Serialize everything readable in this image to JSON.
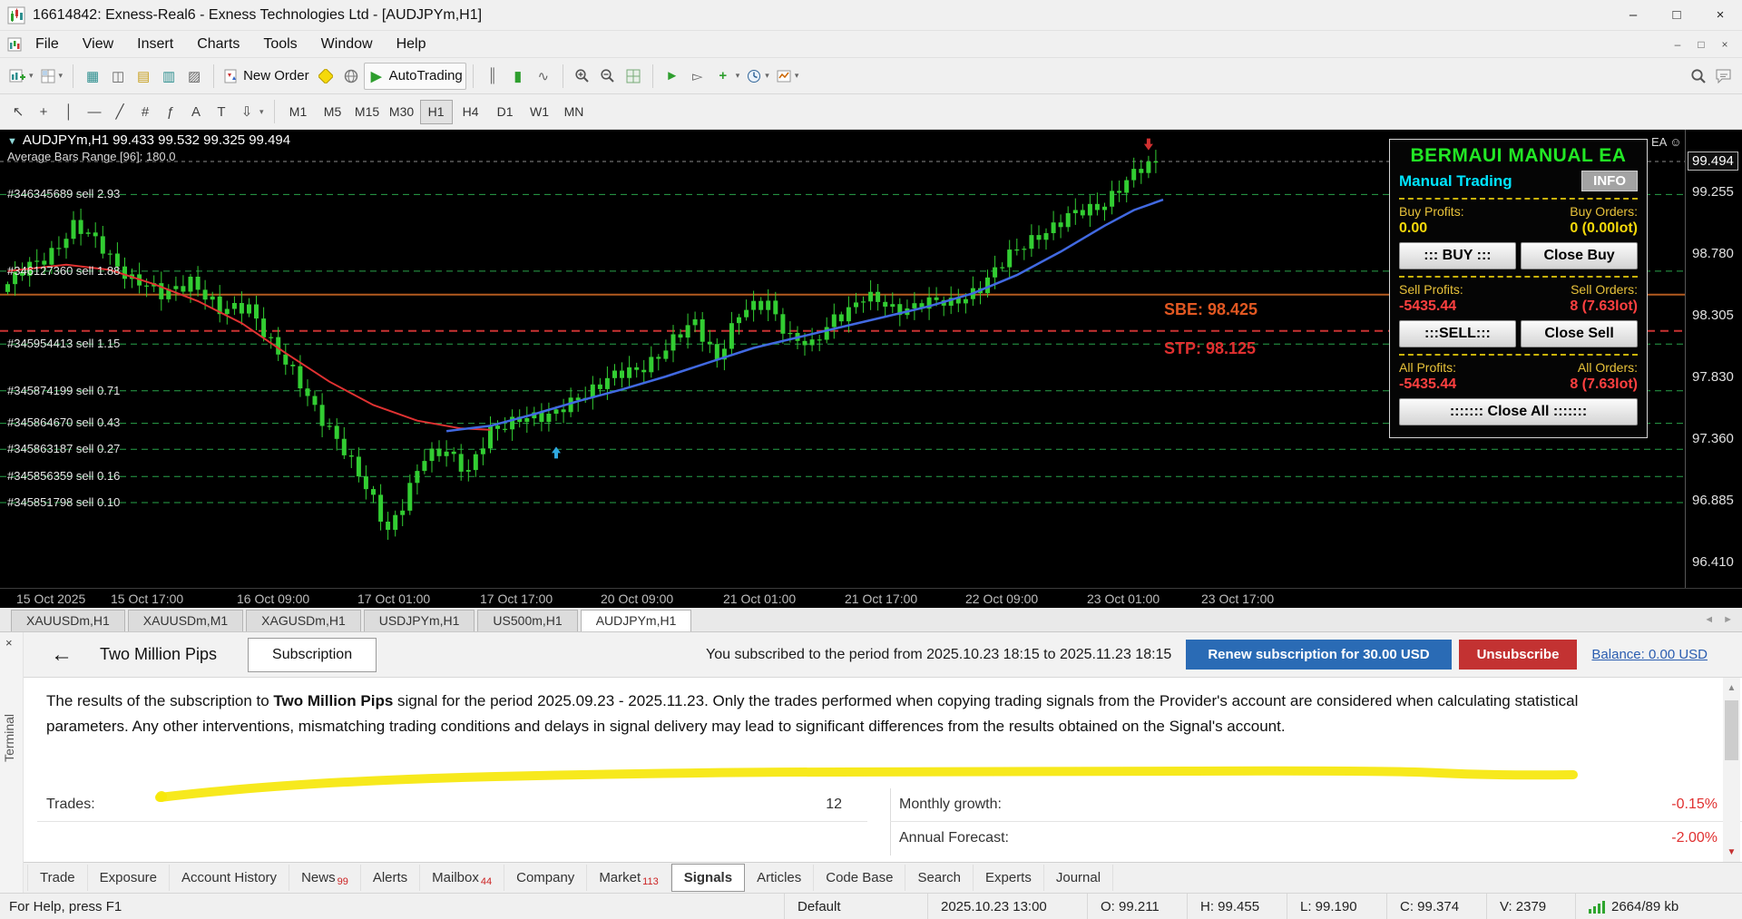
{
  "window": {
    "title": "16614842: Exness-Real6 - Exness Technologies Ltd - [AUDJPYm,H1]"
  },
  "icons": {
    "dropdown": "▾",
    "cursor": "↖",
    "crosshair": "+",
    "vertical_line": "│",
    "horizontal_line": "—",
    "trendline": "╱",
    "channel": "#",
    "fibonacci": "ƒ",
    "text_tool": "A",
    "label_tool": "T",
    "arrows_tool": "⇩",
    "play": "▶",
    "back": "←",
    "minimize": "–",
    "maximize": "□",
    "close": "×",
    "smiley_triangle": "▼",
    "scroll_left": "◄",
    "scroll_right": "►",
    "up": "▲",
    "down": "▼",
    "market_watch": "▦",
    "data_window": "◫",
    "navigator": "▤",
    "terminal_icon": "▥",
    "tester": "▨",
    "tile": "▦",
    "bars_type": "║",
    "candles_type": "▮",
    "line_type": "∿",
    "autoscroll": "►",
    "chart_shift": "▻",
    "indicators": "+"
  },
  "menu": {
    "items": [
      "File",
      "View",
      "Insert",
      "Charts",
      "Tools",
      "Window",
      "Help"
    ]
  },
  "toolbar": {
    "new_order_label": "New Order",
    "autotrading_label": "AutoTrading"
  },
  "timeframes": {
    "items": [
      "M1",
      "M5",
      "M15",
      "M30",
      "H1",
      "H4",
      "D1",
      "W1",
      "MN"
    ],
    "active": "H1"
  },
  "chart": {
    "symbol_line": "AUDJPYm,H1  99.433 99.532 99.325 99.494",
    "info_line": "Average Bars Range [96]: 180.0",
    "ea_smiley": "EA ☺",
    "current_price": "99.494",
    "price_axis": [
      "99.255",
      "98.780",
      "98.305",
      "97.830",
      "97.360",
      "96.885",
      "96.410"
    ],
    "time_axis": [
      "15 Oct 2025",
      "15 Oct 17:00",
      "16 Oct 09:00",
      "17 Oct 01:00",
      "17 Oct 17:00",
      "20 Oct 09:00",
      "21 Oct 01:00",
      "21 Oct 17:00",
      "22 Oct 09:00",
      "23 Oct 01:00",
      "23 Oct 17:00"
    ],
    "sbe_label": "SBE:  98.425",
    "stp_label": "STP:  98.125",
    "orders": [
      {
        "label": "#346345689 sell 2.93",
        "price": 99.24
      },
      {
        "label": "#346127360 sell 1.88",
        "price": 98.65
      },
      {
        "label": "#345954413 sell 1.15",
        "price": 98.09
      },
      {
        "label": "#345874199 sell 0.71",
        "price": 97.73
      },
      {
        "label": "#345864670 sell 0.43",
        "price": 97.48
      },
      {
        "label": "#345863187 sell 0.27",
        "price": 97.28
      },
      {
        "label": "#345856359 sell 0.16",
        "price": 97.07
      },
      {
        "label": "#345851798 sell 0.10",
        "price": 96.87
      }
    ],
    "levels": {
      "sbe": 98.47,
      "stp": 98.19,
      "bid": 99.494
    },
    "candle_anchors": [
      [
        0,
        98.55
      ],
      [
        5,
        98.75
      ],
      [
        9,
        99.0
      ],
      [
        13,
        98.82
      ],
      [
        17,
        98.6
      ],
      [
        21,
        98.45
      ],
      [
        25,
        98.6
      ],
      [
        29,
        98.32
      ],
      [
        33,
        98.4
      ],
      [
        37,
        98.0
      ],
      [
        41,
        97.7
      ],
      [
        44,
        97.45
      ],
      [
        47,
        97.15
      ],
      [
        50,
        96.9
      ],
      [
        52,
        96.68
      ],
      [
        54,
        96.85
      ],
      [
        57,
        97.2
      ],
      [
        60,
        97.3
      ],
      [
        63,
        97.1
      ],
      [
        66,
        97.4
      ],
      [
        70,
        97.55
      ],
      [
        74,
        97.5
      ],
      [
        78,
        97.7
      ],
      [
        82,
        97.8
      ],
      [
        86,
        97.9
      ],
      [
        90,
        98.05
      ],
      [
        94,
        98.25
      ],
      [
        97,
        98.0
      ],
      [
        100,
        98.3
      ],
      [
        104,
        98.42
      ],
      [
        107,
        98.15
      ],
      [
        110,
        98.05
      ],
      [
        113,
        98.3
      ],
      [
        117,
        98.45
      ],
      [
        121,
        98.35
      ],
      [
        125,
        98.42
      ],
      [
        129,
        98.38
      ],
      [
        133,
        98.55
      ],
      [
        137,
        98.75
      ],
      [
        141,
        98.95
      ],
      [
        145,
        99.05
      ],
      [
        149,
        99.15
      ],
      [
        152,
        99.3
      ],
      [
        155,
        99.42
      ],
      [
        157,
        99.47
      ]
    ],
    "ma_red": [
      [
        0,
        98.65
      ],
      [
        8,
        98.7
      ],
      [
        14,
        98.66
      ],
      [
        20,
        98.55
      ],
      [
        26,
        98.42
      ],
      [
        32,
        98.25
      ],
      [
        38,
        98.02
      ],
      [
        44,
        97.8
      ],
      [
        50,
        97.62
      ],
      [
        56,
        97.5
      ],
      [
        62,
        97.44
      ],
      [
        66,
        97.43
      ]
    ],
    "ma_blue": [
      [
        60,
        97.42
      ],
      [
        66,
        97.46
      ],
      [
        72,
        97.55
      ],
      [
        78,
        97.65
      ],
      [
        84,
        97.74
      ],
      [
        90,
        97.84
      ],
      [
        96,
        97.95
      ],
      [
        102,
        98.06
      ],
      [
        108,
        98.14
      ],
      [
        114,
        98.22
      ],
      [
        120,
        98.3
      ],
      [
        126,
        98.38
      ],
      [
        132,
        98.48
      ],
      [
        138,
        98.62
      ],
      [
        144,
        98.8
      ],
      [
        150,
        99.0
      ],
      [
        154,
        99.12
      ],
      [
        158,
        99.2
      ]
    ],
    "arrows": {
      "up": {
        "i": 75,
        "price": 97.3
      },
      "down": {
        "i": 156,
        "price": 99.58
      }
    },
    "colors": {
      "bull": "#32CD32",
      "ma_red": "#E03232",
      "ma_blue": "#4169E1",
      "order_line": "#29A34A",
      "sbe_line": "#B35A1F",
      "stp_line": "#C83232",
      "bid_line": "#8A8A8A",
      "bg": "#000000"
    }
  },
  "panel": {
    "title": "BERMAUI MANUAL EA",
    "subtitle": "Manual Trading",
    "info_button": "INFO",
    "buy_profits_label": "Buy Profits:",
    "buy_orders_label": "Buy Orders:",
    "buy_profits": "0.00",
    "buy_orders": "0 (0.00lot)",
    "buy_button": "::: BUY :::",
    "close_buy_button": "Close Buy",
    "sell_profits_label": "Sell Profits:",
    "sell_orders_label": "Sell Orders:",
    "sell_profits": "-5435.44",
    "sell_orders": "8 (7.63lot)",
    "sell_button": ":::SELL:::",
    "close_sell_button": "Close Sell",
    "all_profits_label": "All Profits:",
    "all_orders_label": "All Orders:",
    "all_profits": "-5435.44",
    "all_orders": "8 (7.63lot)",
    "close_all_button": "::::::: Close All :::::::"
  },
  "chart_tabs": {
    "items": [
      "XAUUSDm,H1",
      "XAUUSDm,M1",
      "XAGUSDm,H1",
      "USDJPYm,H1",
      "US500m,H1",
      "AUDJPYm,H1"
    ],
    "active": "AUDJPYm,H1"
  },
  "signals": {
    "provider": "Two Million Pips",
    "tab": "Subscription",
    "subscribed_text": "You subscribed to the period from 2025.10.23 18:15 to 2025.11.23 18:15",
    "renew_button": "Renew subscription for 30.00 USD",
    "unsubscribe_button": "Unsubscribe",
    "balance_link": "Balance: 0.00 USD",
    "paragraph_pre": "The results of the subscription to ",
    "paragraph_bold": "Two Million Pips",
    "paragraph_post": " signal for the period 2025.09.23 - 2025.11.23. Only the trades performed when copying trading signals from the Provider's account are considered when calculating statistical parameters. Any other interventions, mismatching trading conditions and delays in signal delivery may lead to significant differences from the results obtained on the Signal's account.",
    "stats": {
      "trades_label": "Trades:",
      "trades_value": "12",
      "monthly_growth_label": "Monthly growth:",
      "monthly_growth_value": "-0.15%",
      "annual_forecast_label": "Annual Forecast:",
      "annual_forecast_value": "-2.00%"
    }
  },
  "terminal_tabs": {
    "side_label": "Terminal",
    "items": [
      {
        "label": "Trade"
      },
      {
        "label": "Exposure"
      },
      {
        "label": "Account History"
      },
      {
        "label": "News",
        "badge": "99"
      },
      {
        "label": "Alerts"
      },
      {
        "label": "Mailbox",
        "badge": "44"
      },
      {
        "label": "Company"
      },
      {
        "label": "Market",
        "badge": "113"
      },
      {
        "label": "Signals"
      },
      {
        "label": "Articles"
      },
      {
        "label": "Code Base"
      },
      {
        "label": "Search"
      },
      {
        "label": "Experts"
      },
      {
        "label": "Journal"
      }
    ],
    "active": "Signals"
  },
  "statusbar": {
    "help": "For Help, press F1",
    "profile": "Default",
    "datetime": "2025.10.23 13:00",
    "o": "O: 99.211",
    "h": "H: 99.455",
    "l": "L: 99.190",
    "c": "C: 99.374",
    "v": "V: 2379",
    "traffic": "2664/89 kb"
  }
}
